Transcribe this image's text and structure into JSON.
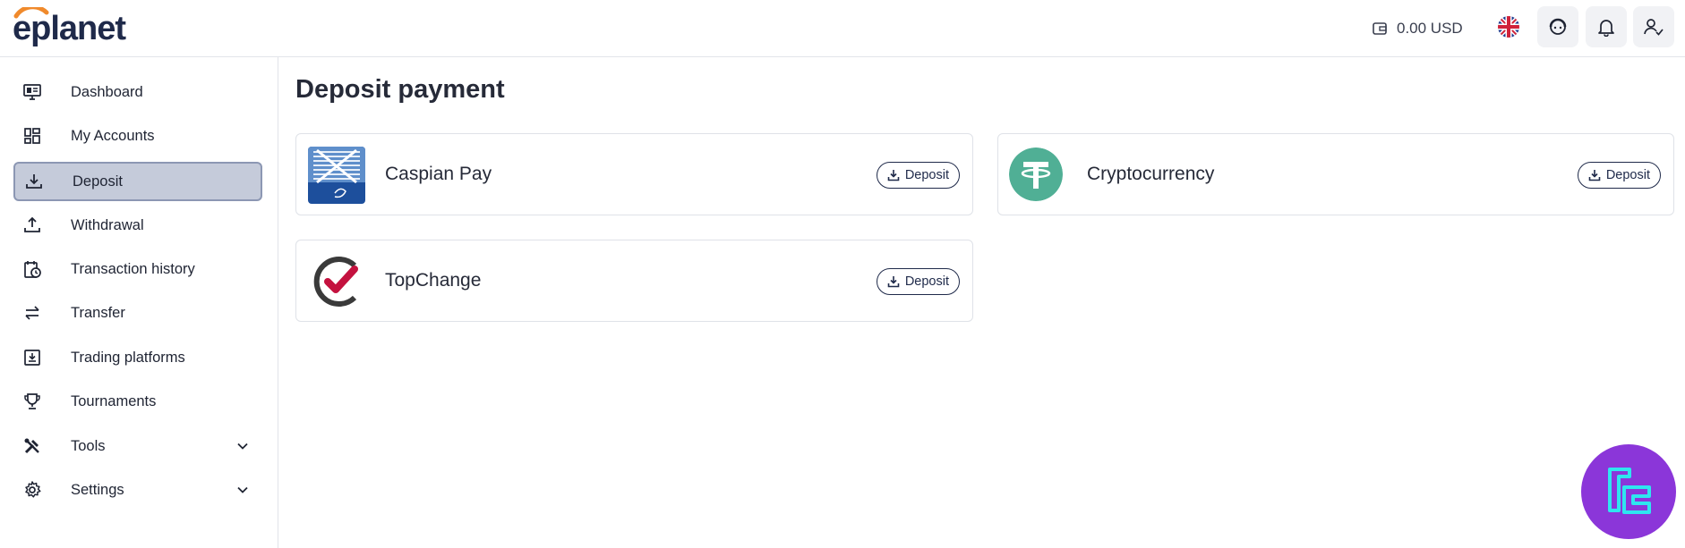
{
  "brand": {
    "name": "eplanet",
    "accent": "#f08a2c",
    "primary": "#1f2a4a"
  },
  "header": {
    "balance": "0.00 USD",
    "language": "English",
    "icons": [
      "wallet-icon",
      "uk-flag-icon",
      "support-icon",
      "bell-icon",
      "user-check-icon"
    ]
  },
  "sidebar": {
    "items": [
      {
        "label": "Dashboard",
        "icon": "monitor-icon"
      },
      {
        "label": "My Accounts",
        "icon": "grid-icon"
      },
      {
        "label": "Deposit",
        "icon": "download-icon",
        "active": true
      },
      {
        "label": "Withdrawal",
        "icon": "upload-icon"
      },
      {
        "label": "Transaction history",
        "icon": "history-icon"
      },
      {
        "label": "Transfer",
        "icon": "transfer-icon"
      },
      {
        "label": "Trading platforms",
        "icon": "platform-download-icon"
      },
      {
        "label": "Tournaments",
        "icon": "trophy-icon"
      },
      {
        "label": "Tools",
        "icon": "tools-icon",
        "expandable": true
      },
      {
        "label": "Settings",
        "icon": "gear-icon",
        "expandable": true
      }
    ]
  },
  "main": {
    "title": "Deposit payment",
    "methods": [
      {
        "name": "Caspian Pay",
        "button": "Deposit"
      },
      {
        "name": "Cryptocurrency",
        "button": "Deposit"
      },
      {
        "name": "TopChange",
        "button": "Deposit"
      }
    ]
  },
  "colors": {
    "active_bg": "#c5cbda",
    "tether_green": "#50af95",
    "badge_purple": "#8b36d9",
    "badge_cyan": "#2ee6f0"
  }
}
